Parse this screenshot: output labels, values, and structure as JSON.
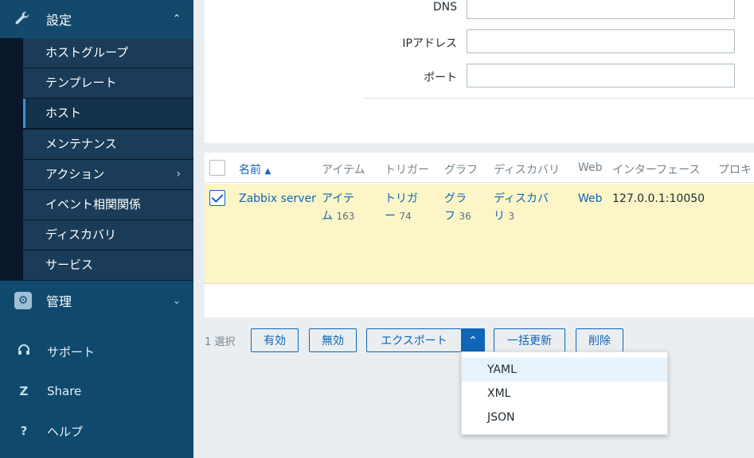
{
  "sidebar": {
    "settings": {
      "label": "設定",
      "icon": "wrench-icon"
    },
    "submenu": [
      {
        "label": "ホストグループ"
      },
      {
        "label": "テンプレート"
      },
      {
        "label": "ホスト",
        "active": true
      },
      {
        "label": "メンテナンス"
      },
      {
        "label": "アクション",
        "has_submenu": true
      },
      {
        "label": "イベント相関関係"
      },
      {
        "label": "ディスカバリ"
      },
      {
        "label": "サービス"
      }
    ],
    "admin": {
      "label": "管理",
      "icon": "gear-icon"
    },
    "links": [
      {
        "label": "サポート",
        "icon": "headset-icon"
      },
      {
        "label": "Share",
        "icon": "share-z-icon"
      },
      {
        "label": "ヘルプ",
        "icon": "help-icon"
      }
    ]
  },
  "filter": {
    "dns_label": "DNS",
    "ip_label": "IPアドレス",
    "port_label": "ポート",
    "dns_value": "",
    "ip_value": "",
    "port_value": ""
  },
  "table": {
    "columns": [
      "名前",
      "アイテム",
      "トリガー",
      "グラフ",
      "ディスカバリ",
      "Web",
      "インターフェース",
      "プロキ"
    ],
    "sort_indicator": "▲",
    "rows": [
      {
        "checked": true,
        "name": "Zabbix server",
        "items_label_1": "アイテ",
        "items_label_2": "ム",
        "items_count": "163",
        "triggers_label_1": "トリガ",
        "triggers_label_2": "ー",
        "triggers_count": "74",
        "graphs_label_1": "グラ",
        "graphs_label_2": "フ",
        "graphs_count": "36",
        "discovery_label_1": "ディスカバ",
        "discovery_label_2": "リ",
        "discovery_count": "3",
        "web": "Web",
        "interface": "127.0.0.1:10050"
      }
    ]
  },
  "actions": {
    "selected": "1 選択",
    "enable": "有効",
    "disable": "無効",
    "export": "エクスポート",
    "mass_update": "一括更新",
    "delete": "削除"
  },
  "export_menu": [
    "YAML",
    "XML",
    "JSON"
  ],
  "colors": {
    "sidebar_bg": "#0f4a6e",
    "accent": "#0f65b7",
    "selected_row": "#fbf5c7"
  }
}
